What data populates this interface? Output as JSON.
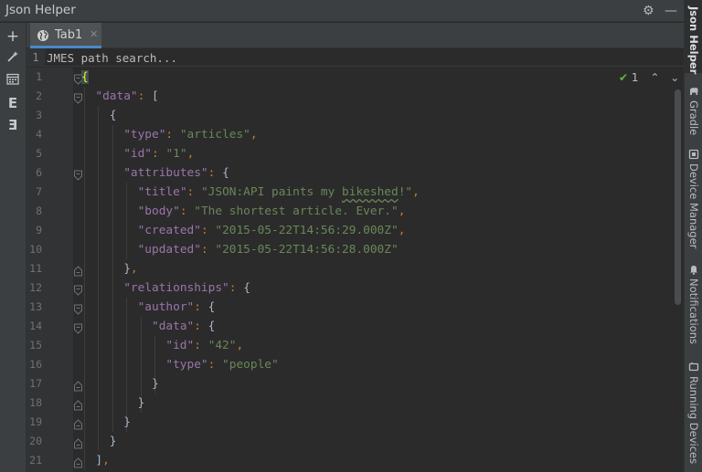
{
  "window": {
    "title": "Json Helper"
  },
  "header": {
    "settings_icon": "gear-icon",
    "minimize_icon": "minus-icon"
  },
  "left_toolbar": {
    "items": [
      {
        "icon": "plus-icon",
        "glyph": "+"
      },
      {
        "icon": "magic-wand-icon",
        "glyph": "⁂"
      },
      {
        "icon": "calendar-icon",
        "glyph": "▦"
      },
      {
        "icon": "format-e-icon",
        "glyph": "E"
      },
      {
        "icon": "compact-e-icon",
        "glyph": "Ǝ"
      }
    ]
  },
  "tabs": [
    {
      "label": "Tab1",
      "icon": "globe-icon",
      "active": true
    }
  ],
  "search": {
    "line": "1",
    "placeholder": "JMES path search..."
  },
  "inspection": {
    "count": "1"
  },
  "editor": {
    "lines": [
      {
        "n": "1",
        "indent": 0,
        "tokens": [
          {
            "t": "{",
            "c": "bhl"
          }
        ]
      },
      {
        "n": "2",
        "indent": 1,
        "tokens": [
          {
            "t": "\"data\"",
            "c": "k"
          },
          {
            "t": ": ",
            "c": "p"
          },
          {
            "t": "[",
            "c": "b"
          }
        ]
      },
      {
        "n": "3",
        "indent": 2,
        "tokens": [
          {
            "t": "{",
            "c": "b"
          }
        ]
      },
      {
        "n": "4",
        "indent": 3,
        "tokens": [
          {
            "t": "\"type\"",
            "c": "k"
          },
          {
            "t": ": ",
            "c": "p"
          },
          {
            "t": "\"articles\"",
            "c": "s"
          },
          {
            "t": ",",
            "c": "p"
          }
        ]
      },
      {
        "n": "5",
        "indent": 3,
        "tokens": [
          {
            "t": "\"id\"",
            "c": "k"
          },
          {
            "t": ": ",
            "c": "p"
          },
          {
            "t": "\"1\"",
            "c": "s"
          },
          {
            "t": ",",
            "c": "p"
          }
        ]
      },
      {
        "n": "6",
        "indent": 3,
        "tokens": [
          {
            "t": "\"attributes\"",
            "c": "k"
          },
          {
            "t": ": ",
            "c": "p"
          },
          {
            "t": "{",
            "c": "b"
          }
        ]
      },
      {
        "n": "7",
        "indent": 4,
        "tokens": [
          {
            "t": "\"title\"",
            "c": "k"
          },
          {
            "t": ": ",
            "c": "p"
          },
          {
            "t": "\"JSON:API paints my ",
            "c": "s"
          },
          {
            "t": "bikeshed",
            "c": "s wavy"
          },
          {
            "t": "!\"",
            "c": "s"
          },
          {
            "t": ",",
            "c": "p"
          }
        ]
      },
      {
        "n": "8",
        "indent": 4,
        "tokens": [
          {
            "t": "\"body\"",
            "c": "k"
          },
          {
            "t": ": ",
            "c": "p"
          },
          {
            "t": "\"The shortest article. Ever.\"",
            "c": "s"
          },
          {
            "t": ",",
            "c": "p"
          }
        ]
      },
      {
        "n": "9",
        "indent": 4,
        "tokens": [
          {
            "t": "\"created\"",
            "c": "k"
          },
          {
            "t": ": ",
            "c": "p"
          },
          {
            "t": "\"2015-05-22T14:56:29.000Z\"",
            "c": "s"
          },
          {
            "t": ",",
            "c": "p"
          }
        ]
      },
      {
        "n": "10",
        "indent": 4,
        "tokens": [
          {
            "t": "\"updated\"",
            "c": "k"
          },
          {
            "t": ": ",
            "c": "p"
          },
          {
            "t": "\"2015-05-22T14:56:28.000Z\"",
            "c": "s"
          }
        ]
      },
      {
        "n": "11",
        "indent": 3,
        "tokens": [
          {
            "t": "}",
            "c": "b"
          },
          {
            "t": ",",
            "c": "p"
          }
        ]
      },
      {
        "n": "12",
        "indent": 3,
        "tokens": [
          {
            "t": "\"relationships\"",
            "c": "k"
          },
          {
            "t": ": ",
            "c": "p"
          },
          {
            "t": "{",
            "c": "b"
          }
        ]
      },
      {
        "n": "13",
        "indent": 4,
        "tokens": [
          {
            "t": "\"author\"",
            "c": "k"
          },
          {
            "t": ": ",
            "c": "p"
          },
          {
            "t": "{",
            "c": "b"
          }
        ]
      },
      {
        "n": "14",
        "indent": 5,
        "tokens": [
          {
            "t": "\"data\"",
            "c": "k"
          },
          {
            "t": ": ",
            "c": "p"
          },
          {
            "t": "{",
            "c": "b"
          }
        ]
      },
      {
        "n": "15",
        "indent": 6,
        "tokens": [
          {
            "t": "\"id\"",
            "c": "k"
          },
          {
            "t": ": ",
            "c": "p"
          },
          {
            "t": "\"42\"",
            "c": "s"
          },
          {
            "t": ",",
            "c": "p"
          }
        ]
      },
      {
        "n": "16",
        "indent": 6,
        "tokens": [
          {
            "t": "\"type\"",
            "c": "k"
          },
          {
            "t": ": ",
            "c": "p"
          },
          {
            "t": "\"people\"",
            "c": "s"
          }
        ]
      },
      {
        "n": "17",
        "indent": 5,
        "tokens": [
          {
            "t": "}",
            "c": "b"
          }
        ]
      },
      {
        "n": "18",
        "indent": 4,
        "tokens": [
          {
            "t": "}",
            "c": "b"
          }
        ]
      },
      {
        "n": "19",
        "indent": 3,
        "tokens": [
          {
            "t": "}",
            "c": "b"
          }
        ]
      },
      {
        "n": "20",
        "indent": 2,
        "tokens": [
          {
            "t": "}",
            "c": "b"
          }
        ]
      },
      {
        "n": "21",
        "indent": 1,
        "tokens": [
          {
            "t": "]",
            "c": "b"
          },
          {
            "t": ",",
            "c": "p"
          }
        ]
      }
    ]
  },
  "right_toolbar": {
    "tabs": [
      {
        "label": "Json Helper",
        "icon": "",
        "active": true
      },
      {
        "label": "Gradle",
        "icon": "elephant-icon",
        "active": false
      },
      {
        "label": "Device Manager",
        "icon": "device-icon",
        "active": false
      },
      {
        "label": "Notifications",
        "icon": "bell-icon",
        "active": false
      },
      {
        "label": "Running Devices",
        "icon": "phone-icon",
        "active": false
      }
    ]
  },
  "colors": {
    "background": "#2b2b2b",
    "panel": "#3c3f41",
    "key": "#9876aa",
    "string": "#6a8759",
    "punctuation": "#cc7832",
    "accent": "#4a88c7",
    "ok": "#62b543"
  }
}
